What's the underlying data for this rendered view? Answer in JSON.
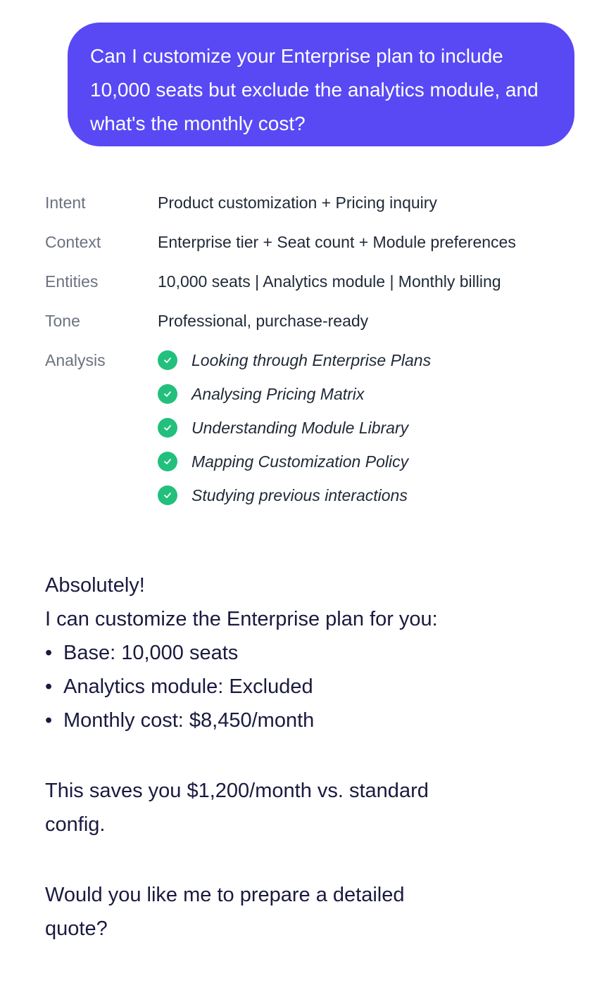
{
  "user_message": {
    "text": "Can I customize your Enterprise plan to include 10,000 seats but exclude the analytics module, and what's the monthly cost?"
  },
  "meta": {
    "intent": {
      "label": "Intent",
      "value": "Product customization + Pricing inquiry"
    },
    "context": {
      "label": "Context",
      "value": "Enterprise tier + Seat count + Module preferences"
    },
    "entities": {
      "label": "Entities",
      "value": "10,000 seats | Analytics module | Monthly billing"
    },
    "tone": {
      "label": "Tone",
      "value": "Professional, purchase-ready"
    },
    "analysis": {
      "label": "Analysis",
      "steps": [
        "Looking through Enterprise Plans",
        "Analysing Pricing Matrix",
        "Understanding Module Library",
        "Mapping Customization Policy",
        "Studying previous interactions"
      ]
    }
  },
  "reply": {
    "greeting": "Absolutely!",
    "intro": "I can customize the Enterprise plan for you:",
    "bullet_char": "•",
    "bullets": [
      "Base: 10,000 seats",
      "Analytics module: Excluded",
      "Monthly cost: $8,450/month"
    ],
    "savings": "This saves you $1,200/month vs. standard config.",
    "question": "Would you like me to prepare a detailed quote?"
  },
  "colors": {
    "user_bubble": "#5849f5",
    "check": "#22c07c",
    "label": "#6b7280",
    "reply_text": "#1a1a40"
  },
  "icons": {
    "analysis_step": "check-circle-icon"
  }
}
